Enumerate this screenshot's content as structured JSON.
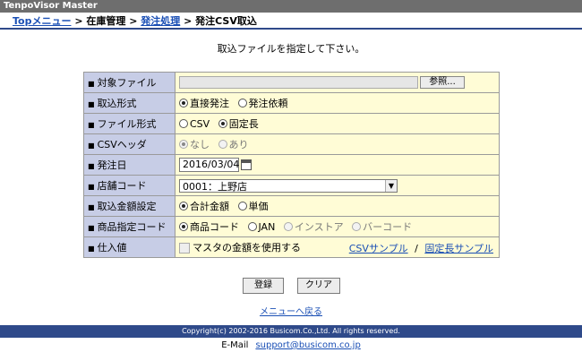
{
  "app_title": "TenpoVisor Master",
  "breadcrumb": {
    "top": "Topメニュー",
    "sep1": " > ",
    "inventory": "在庫管理",
    "sep2": " > ",
    "order": "発注処理",
    "sep3": " > ",
    "current": "発注CSV取込"
  },
  "instruction": "取込ファイルを指定して下さい。",
  "form": {
    "target_file": {
      "label": "対象ファイル",
      "button": "参照..."
    },
    "import_format": {
      "label": "取込形式",
      "options": [
        "直接発注",
        "発注依頼"
      ]
    },
    "file_format": {
      "label": "ファイル形式",
      "options": [
        "CSV",
        "固定長"
      ]
    },
    "csv_header": {
      "label": "CSVヘッダ",
      "options": [
        "なし",
        "あり"
      ]
    },
    "order_date": {
      "label": "発注日",
      "value": "2016/03/04"
    },
    "store_code": {
      "label": "店舗コード",
      "value": "0001：上野店"
    },
    "amount_setting": {
      "label": "取込金額設定",
      "options": [
        "合計金額",
        "単価"
      ]
    },
    "product_code": {
      "label": "商品指定コード",
      "options": [
        "商品コード",
        "JAN",
        "インストア",
        "バーコード"
      ]
    },
    "cost": {
      "label": "仕入値",
      "checkbox": "マスタの金額を使用する",
      "csv_sample": "CSVサンプル",
      "link_sep": "/",
      "fixed_sample": "固定長サンプル"
    }
  },
  "buttons": {
    "register": "登録",
    "clear": "クリア"
  },
  "menu_back": "メニューへ戻る",
  "footer": "Copyright(c) 2002-2016 Busicom.Co.,Ltd. All rights reserved.",
  "email": {
    "label": "E-Mail",
    "address": "support@busicom.co.jp"
  },
  "colors": {
    "label_bg": "#c7cde6",
    "value_bg": "#fffcd6",
    "footer_bg": "#2f4a8a",
    "link": "#1a4fb5"
  }
}
